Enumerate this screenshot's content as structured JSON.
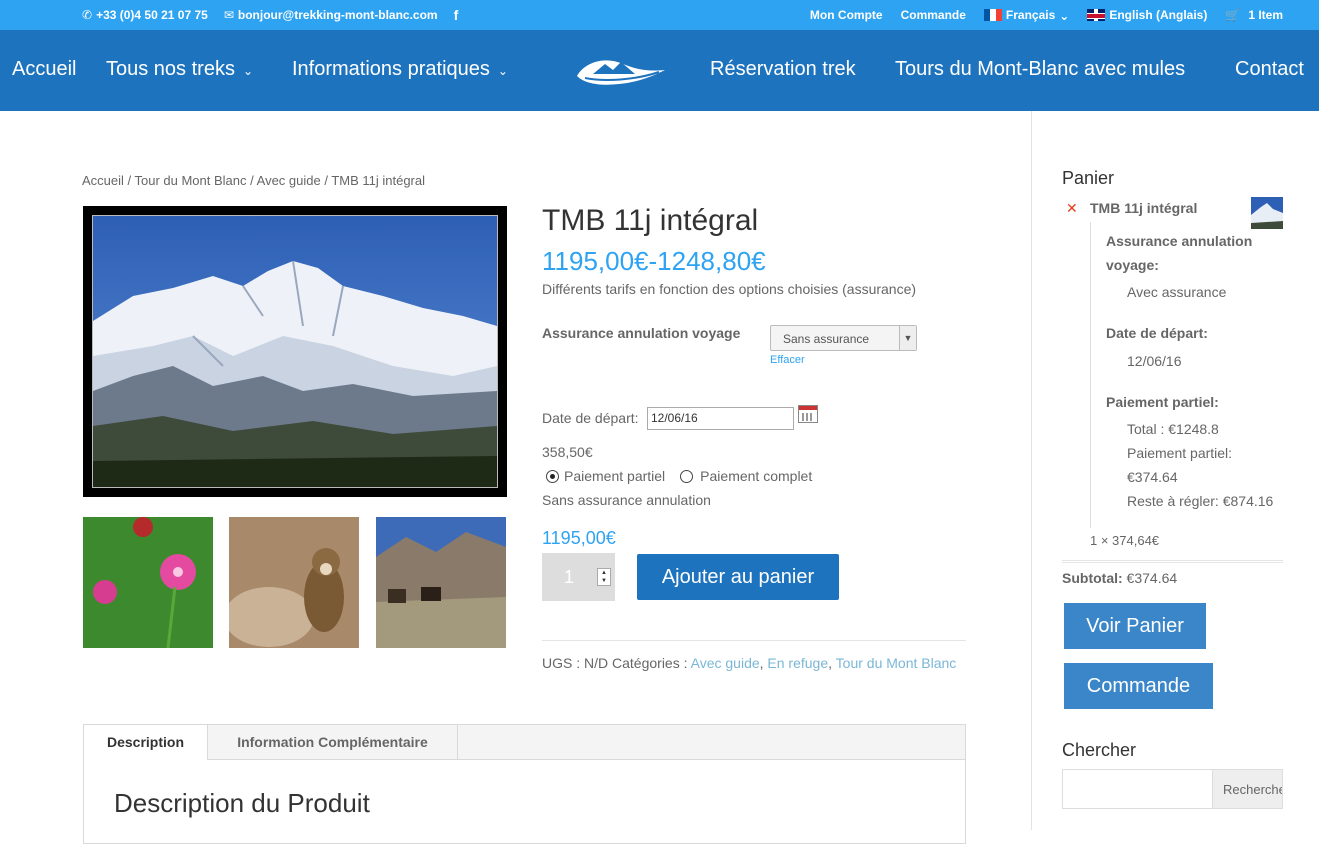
{
  "topbar": {
    "phone": "+33 (0)4 50 21 07 75",
    "email": "bonjour@trekking-mont-blanc.com",
    "social_icon": "facebook-icon",
    "account": "Mon Compte",
    "order": "Commande",
    "lang_fr": "Français",
    "lang_en": "English (Anglais)",
    "cart": "1 Item"
  },
  "nav": {
    "items": [
      "Accueil",
      "Tous nos treks",
      "Informations pratiques",
      "Réservation trek",
      "Tours du Mont-Blanc avec mules",
      "Contact"
    ]
  },
  "breadcrumb": "Accueil / Tour du Mont Blanc / Avec guide / TMB 11j intégral",
  "product": {
    "title": "TMB 11j intégral",
    "price_range": "1195,00€-1248,80€",
    "price_note": "Différents tarifs en fonction des options choisies (assurance)",
    "variation_label": "Assurance annulation voyage",
    "variation_value": "Sans assurance",
    "clear_label": "Effacer",
    "date_label": "Date de départ:",
    "date_value": "12/06/16",
    "deposit_amount": "358,50€",
    "payment_partial": "Paiement partiel",
    "payment_full": "Paiement complet",
    "insurance_note": "Sans assurance annulation",
    "variation_price": "1195,00€",
    "quantity": "1",
    "add_to_cart": "Ajouter au panier",
    "meta_sku": "UGS : N/D",
    "meta_cat_label": "Catégories :",
    "meta_cat1": "Avec guide",
    "meta_cat2": "En refuge",
    "meta_cat3": "Tour du Mont Blanc"
  },
  "tabs": {
    "description": "Description",
    "info": "Information Complémentaire",
    "heading": "Description du Produit"
  },
  "sidebar": {
    "cart_title": "Panier",
    "item_name": "TMB 11j intégral",
    "ins_label": "Assurance annulation voyage:",
    "ins_value": "Avec assurance",
    "date_label": "Date de départ:",
    "date_value": "12/06/16",
    "pay_label": "Paiement partiel:",
    "total": "Total : €1248.8",
    "partial": "Paiement partiel: €374.64",
    "remaining": "Reste à régler: €874.16",
    "qty_line": "1 × 374,64€",
    "subtotal_label": "Subtotal:",
    "subtotal_value": "€374.64",
    "view_cart": "Voir Panier",
    "checkout": "Commande",
    "search_title": "Chercher",
    "search_button": "Rechercher"
  }
}
